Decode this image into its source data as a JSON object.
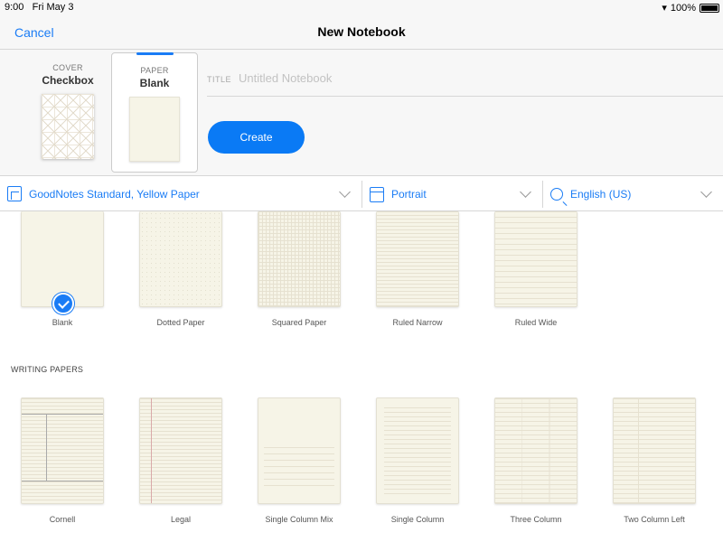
{
  "status": {
    "time": "9:00",
    "date": "Fri May 3",
    "battery": "100%",
    "battery_level": 1.0
  },
  "nav": {
    "cancel": "Cancel",
    "title": "New Notebook"
  },
  "cover": {
    "caption": "COVER",
    "name": "Checkbox"
  },
  "paper": {
    "caption": "PAPER",
    "name": "Blank"
  },
  "title_field": {
    "label": "TITLE",
    "value": "",
    "placeholder": "Untitled Notebook"
  },
  "create_label": "Create",
  "dropdowns": {
    "template": "GoodNotes Standard, Yellow Paper",
    "orientation": "Portrait",
    "language": "English (US)"
  },
  "basic_papers": [
    {
      "name": "Blank",
      "pattern": "blank",
      "selected": true
    },
    {
      "name": "Dotted Paper",
      "pattern": "dotted"
    },
    {
      "name": "Squared Paper",
      "pattern": "squared"
    },
    {
      "name": "Ruled Narrow",
      "pattern": "ruled-narrow"
    },
    {
      "name": "Ruled Wide",
      "pattern": "ruled-wide"
    }
  ],
  "writing_section": "WRITING PAPERS",
  "writing_papers": [
    {
      "name": "Cornell",
      "pattern": "cornell"
    },
    {
      "name": "Legal",
      "pattern": "legal"
    },
    {
      "name": "Single Column Mix",
      "pattern": "mix"
    },
    {
      "name": "Single Column",
      "pattern": "single"
    },
    {
      "name": "Three Column",
      "pattern": "three"
    },
    {
      "name": "Two Column Left",
      "pattern": "twoleft"
    }
  ],
  "colors": {
    "accent": "#1a7cf5",
    "paper": "#f6f4e7"
  }
}
